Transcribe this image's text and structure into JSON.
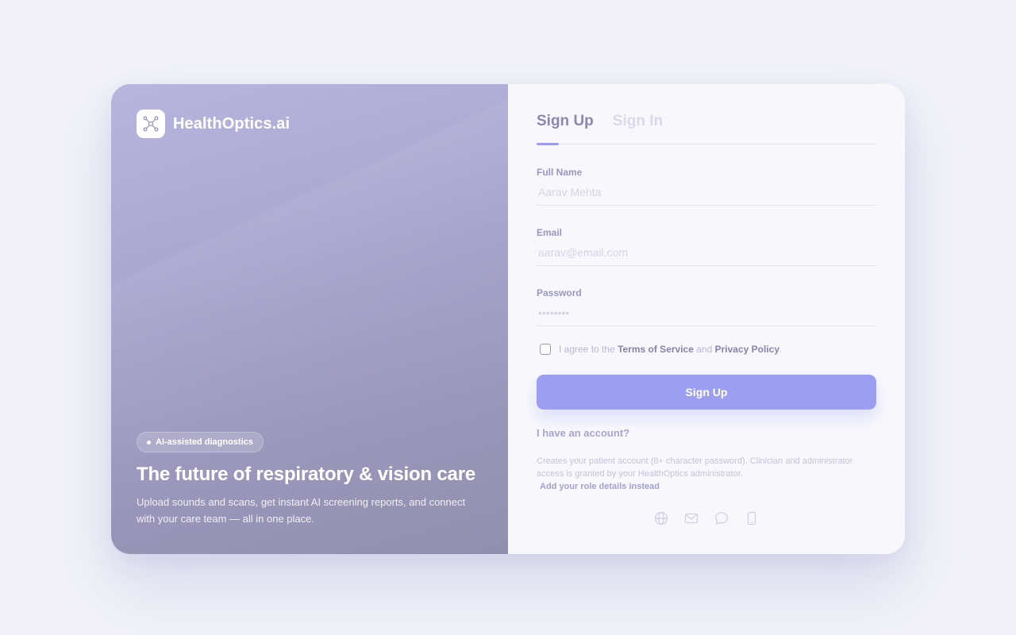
{
  "brand": {
    "name": "HealthOptics.ai"
  },
  "hero": {
    "badge": "AI-assisted diagnostics",
    "title": "The future of respiratory & vision care",
    "description": "Upload sounds and scans, get instant AI screening reports, and connect with your care team — all in one place."
  },
  "tabs": [
    {
      "label": "Sign Up",
      "active": true
    },
    {
      "label": "Sign In",
      "active": false
    }
  ],
  "form": {
    "full_name": {
      "label": "Full Name",
      "value": "",
      "placeholder": "Aarav Mehta"
    },
    "email": {
      "label": "Email",
      "value": "",
      "placeholder": "aarav@email.com"
    },
    "password": {
      "label": "Password",
      "value": "",
      "placeholder": "••••••••"
    },
    "agree": {
      "prefix": "I agree to the",
      "terms": "Terms of Service",
      "and": "and",
      "privacy": "Privacy Policy",
      "suffix": "."
    },
    "submit_label": "Sign Up",
    "have_account": "I have an account?",
    "note": "Creates your patient account (8+ character password). Clinician and administrator access is granted by your HealthOptics administrator.",
    "note_link": "Add your role details instead"
  },
  "social_icons": [
    "globe-icon",
    "mail-icon",
    "chat-icon",
    "phone-icon"
  ],
  "colors": {
    "accent": "#9c9ef2",
    "hero_top": "#b8b6de",
    "hero_bottom": "#928ead",
    "background": "#f2f2f8"
  }
}
